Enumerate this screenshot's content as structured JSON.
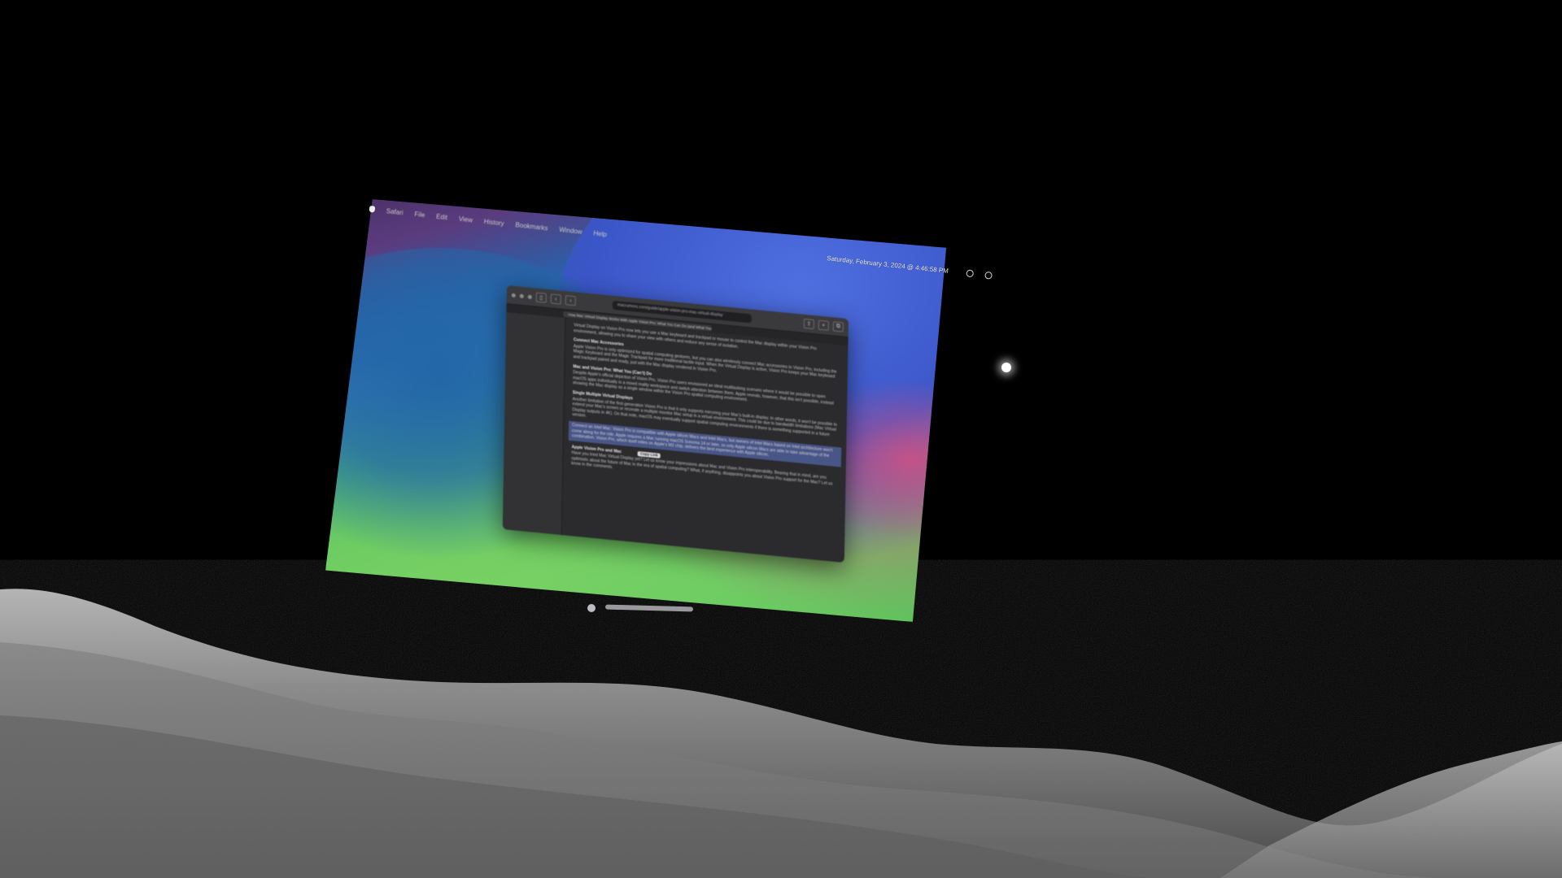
{
  "environment": {
    "name": "Moon",
    "background_color": "#000000",
    "terrain_color": "#9a9a9a"
  },
  "menubar": {
    "items": [
      "Safari",
      "File",
      "Edit",
      "View",
      "History",
      "Bookmarks",
      "Window",
      "Help"
    ],
    "clock": "Saturday, February 3, 2024 @ 4:46:58 PM"
  },
  "safari": {
    "address": "macrumors.com/guide/apple-vision-pro-mac-virtual-display",
    "tab_title": "How Mac Virtual Display Works With Apple Vision Pro: What You Can Do (and What You Can't)",
    "article": {
      "blocks": [
        {
          "type": "para",
          "text": "Virtual Display on Vision Pro now lets you use a Mac keyboard and trackpad or mouse to control the Mac display within your Vision Pro environment, allowing you to share your view with others and reduce any sense of isolation."
        },
        {
          "type": "heading",
          "text": "Connect Mac Accessories"
        },
        {
          "type": "para",
          "text": "Apple Vision Pro is only optimized for spatial computing gestures, but you can also wirelessly connect Mac accessories to Vision Pro, including the Magic Keyboard and the Magic Trackpad for more traditional tactile input. When the Virtual Display is active, Vision Pro keeps your Mac keyboard and trackpad paired and ready, just with the Mac display rendered in Vision Pro."
        },
        {
          "type": "heading",
          "text": "Mac and Vision Pro: What You (Can't) Do"
        },
        {
          "type": "para",
          "text": "Despite Apple's official depiction of Vision Pro, Vision Pro users envisioned an ideal multitasking scenario where it would be possible to open macOS apps individually in a mixed reality workspace and switch attention between them. Apple reveals, however, that this isn't possible, instead showing the Mac display as a single window within the Vision Pro spatial computing environment."
        },
        {
          "type": "heading",
          "text": "Single Multiple Virtual Displays"
        },
        {
          "type": "para",
          "text": "Another limitation of the first-generation Vision Pro is that it only supports mirroring your Mac's built-in display. In other words, it won't be possible to extend your Mac's screen or recreate a multiple monitor Mac setup in a virtual environment. This could be due to bandwidth limitations (Mac Virtual Display outputs in 4K). On that note, macOS may eventually support spatial computing environments if there is something supported in a future version."
        },
        {
          "type": "highlight",
          "text": "Connect an Intel Mac: Vision Pro is compatible with Apple silicon Macs and Intel Macs, but owners of Intel Macs based on Intel architecture won't come along for the ride. Apple requires a Mac running macOS Sonoma 14 or later, so only Apple silicon Macs are able to take advantage of the combination. Vision Pro, which itself relies on Apple's M2 chip, delivers the best experience with Apple silicon."
        },
        {
          "type": "heading",
          "text": "Apple Vision Pro and Mac"
        },
        {
          "type": "para",
          "text": "Have you tried Mac Virtual Display yet? Let us know your impressions about Mac and Vision Pro interoperability. Bearing that in mind, are you optimistic about the future of Mac in the era of spatial computing? What, if anything, disappoints you about Vision Pro support for the Mac? Let us know in the comments."
        }
      ],
      "tooltip": "Copy Link"
    }
  }
}
